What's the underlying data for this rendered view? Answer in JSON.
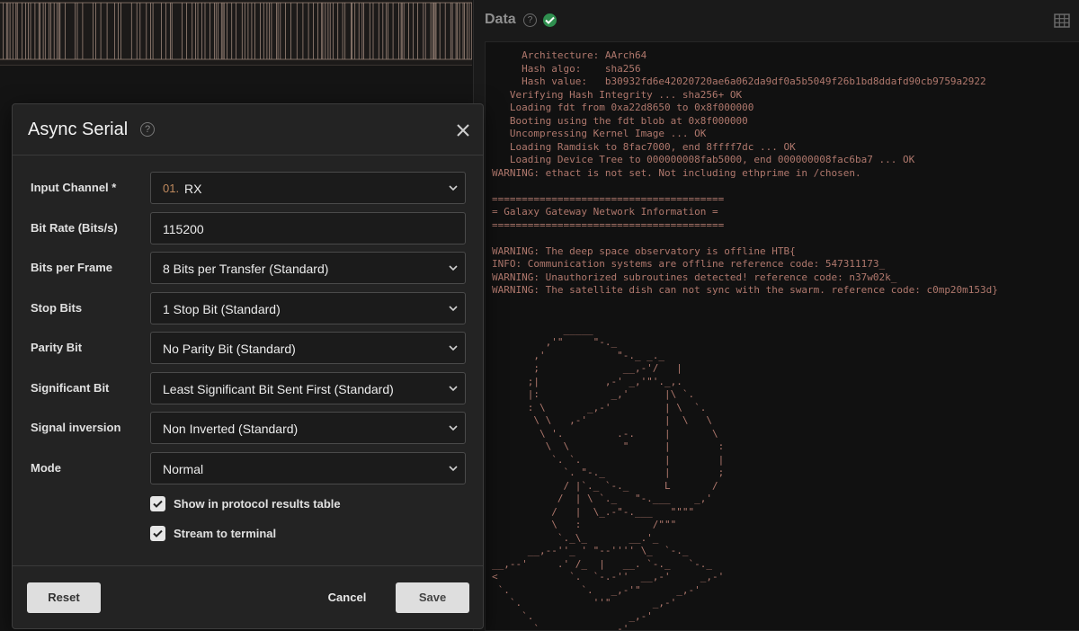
{
  "dialog": {
    "title": "Async Serial",
    "help_icon": "?",
    "fields": {
      "input_channel": {
        "label": "Input Channel *",
        "prefix": "01.",
        "value": "RX"
      },
      "bit_rate": {
        "label": "Bit Rate (Bits/s)",
        "value": "115200"
      },
      "bits_per_frame": {
        "label": "Bits per Frame",
        "value": "8 Bits per Transfer (Standard)"
      },
      "stop_bits": {
        "label": "Stop Bits",
        "value": "1 Stop Bit (Standard)"
      },
      "parity_bit": {
        "label": "Parity Bit",
        "value": "No Parity Bit (Standard)"
      },
      "significant_bit": {
        "label": "Significant Bit",
        "value": "Least Significant Bit Sent First (Standard)"
      },
      "signal_inversion": {
        "label": "Signal inversion",
        "value": "Non Inverted (Standard)"
      },
      "mode": {
        "label": "Mode",
        "value": "Normal"
      }
    },
    "checkboxes": {
      "show_in_table": {
        "label": "Show in protocol results table",
        "checked": true
      },
      "stream_to_terminal": {
        "label": "Stream to terminal",
        "checked": true
      }
    },
    "buttons": {
      "reset": "Reset",
      "cancel": "Cancel",
      "save": "Save"
    }
  },
  "data_panel": {
    "title": "Data",
    "help_icon": "?",
    "status_icon": "check-circle-icon",
    "view_icon": "table-icon",
    "terminal_text": "     Architecture: AArch64\n     Hash algo:    sha256\n     Hash value:   b30932fd6e42020720ae6a062da9df0a5b5049f26b1bd8ddafd90cb9759a2922\n   Verifying Hash Integrity ... sha256+ OK\n   Loading fdt from 0xa22d8650 to 0x8f000000\n   Booting using the fdt blob at 0x8f000000\n   Uncompressing Kernel Image ... OK\n   Loading Ramdisk to 8fac7000, end 8ffff7dc ... OK\n   Loading Device Tree to 000000008fab5000, end 000000008fac6ba7 ... OK\nWARNING: ethact is not set. Not including ethprime in /chosen.\n\n=======================================\n= Galaxy Gateway Network Information =\n=======================================\n\nWARNING: The deep space observatory is offline HTB{\nINFO: Communication systems are offline reference code: 547311173_\nWARNING: Unauthorized subroutines detected! reference code: n37w02k_\nWARNING: The satellite dish can not sync with the swarm. reference code: c0mp20m153d}\n\n\n            _____\n         ,'\"     \"-._\n       ,'            \"-._ _._\n       ;              __,-'/   |\n      ;|           ,-' _,'\"'._,.\n      |:            _,'      |\\ `.\n      : \\       _,-'         | \\  `.\n       \\ \\   ,-'             |  \\   \\\n        \\ '.         .-.     |       \\\n         \\  \\         \"      |        :\n          `. `.              |        |\n            `. \"-._          |        ;\n            / |`._ `-._      L       /\n           /  | \\ `._   \"-.___    _,'\n          /   |  \\_.-\"-.___   \"\"\"\"\n          \\   :            /\"\"\"\n           `._\\_       __.'_\n      __,--''_ ' \"--'''' \\_  `-._\n__,--'     .' /_  |   __. `-._   `-._\n<            `.  `-.-''  __,-'     _,-'\n `.            `.   _,-'\"      _,-'\n   `.            ''\"       _,-'\n     `.                _,-'\n       `.          _,-'\n         `.   __,'\"\n           `'\""
  }
}
